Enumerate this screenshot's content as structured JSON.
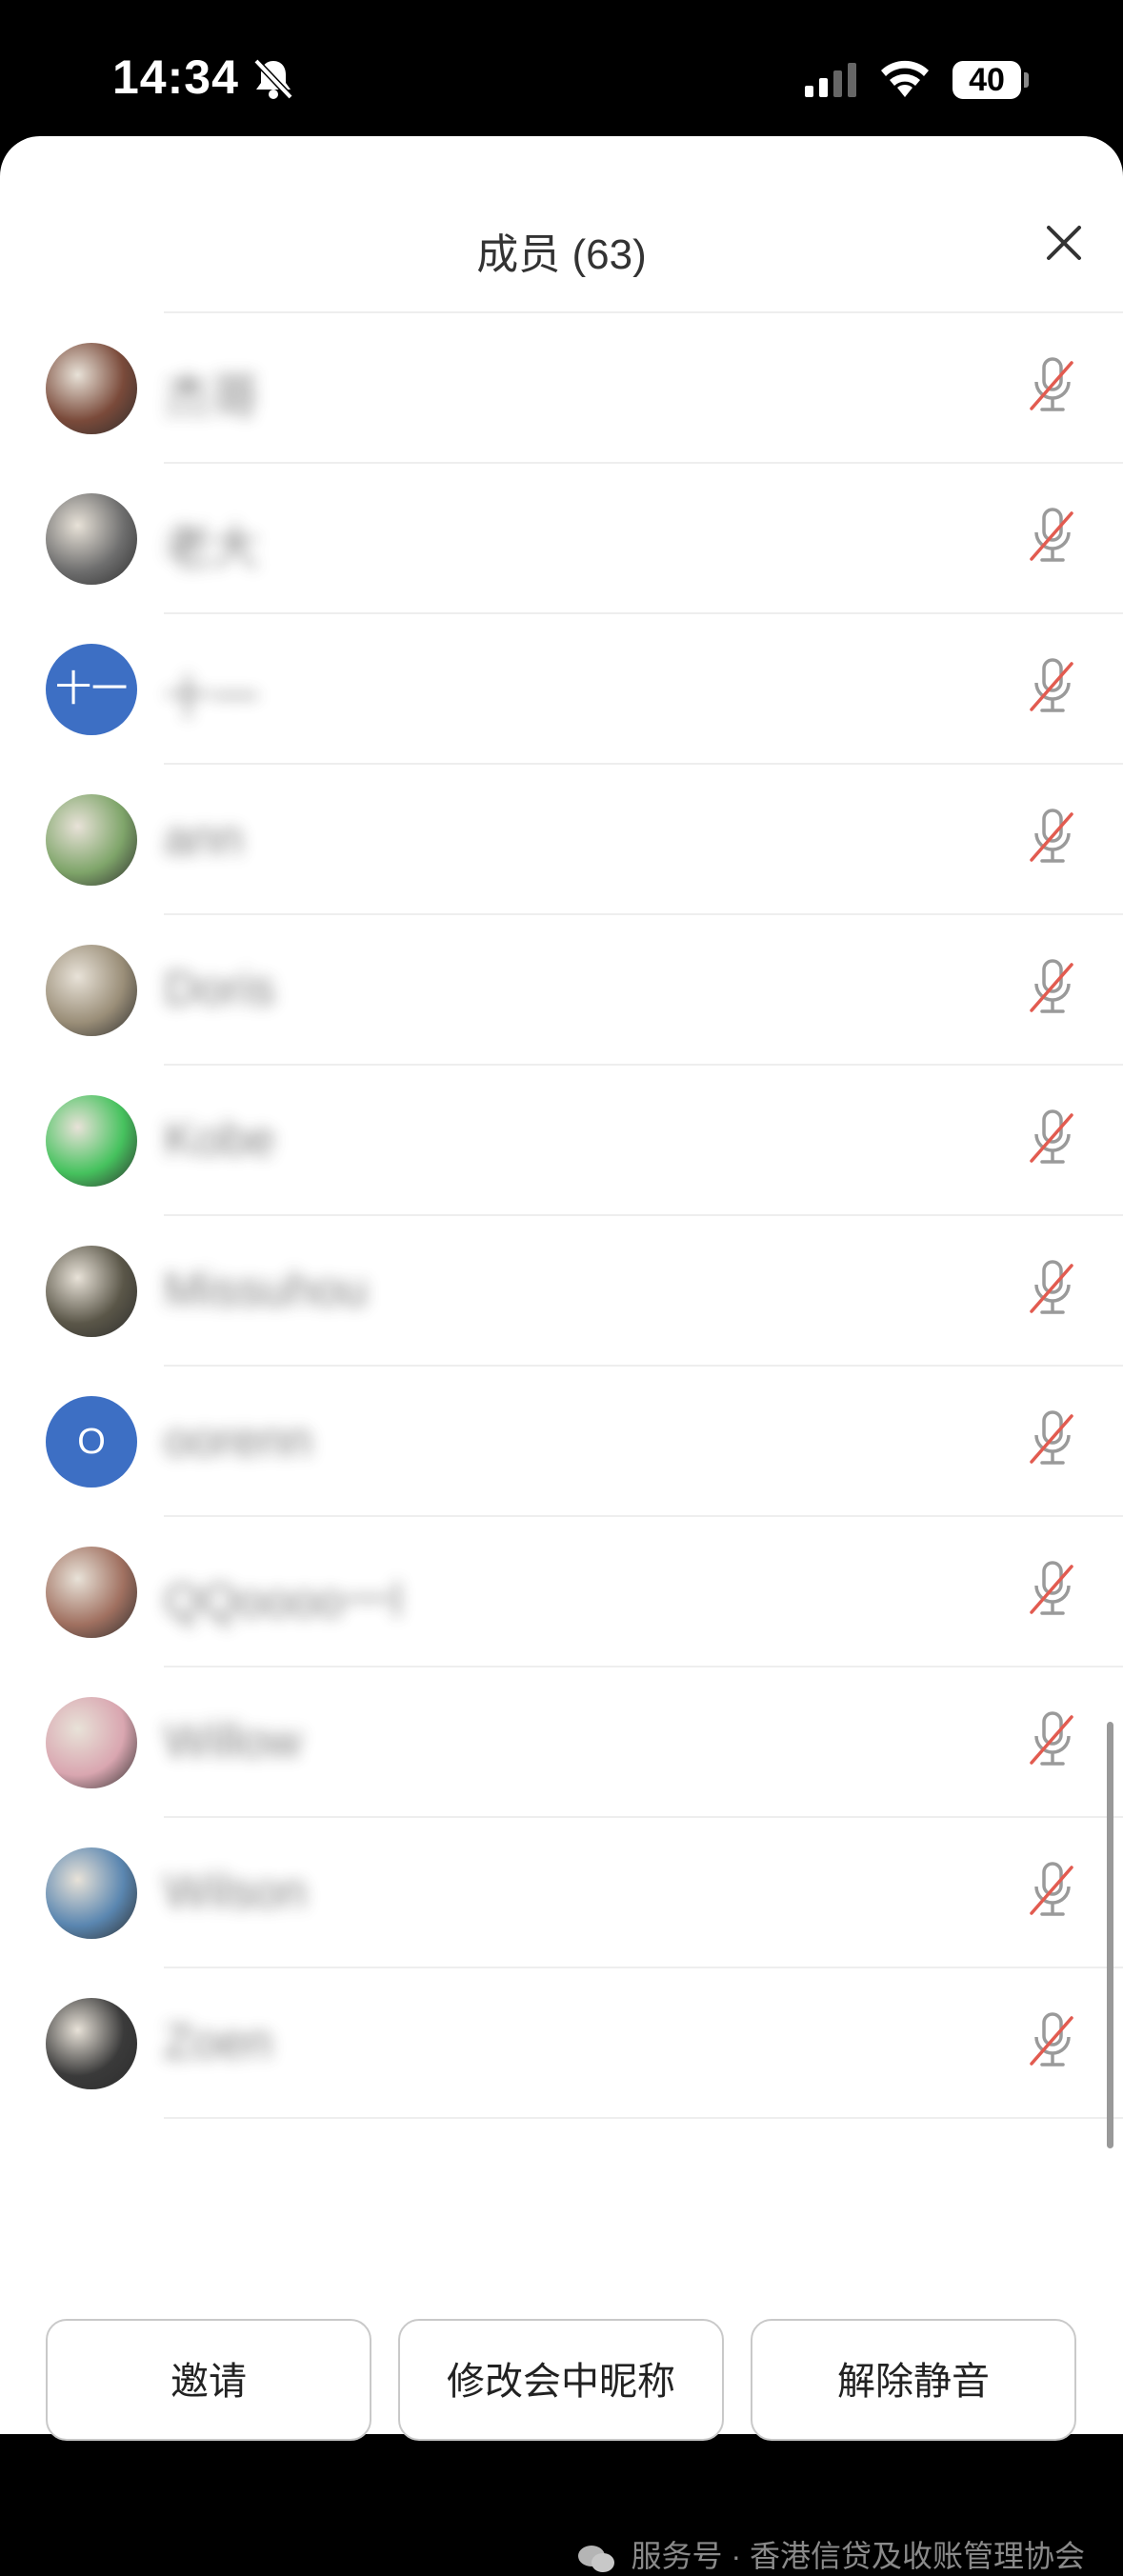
{
  "status": {
    "time": "14:34",
    "battery": "40"
  },
  "sheet": {
    "title": "成员 (63)"
  },
  "members": [
    {
      "name": "杰哥",
      "avatar": "photo",
      "avatar_color": "#7a4a3a"
    },
    {
      "name": "老大",
      "avatar": "photo",
      "avatar_color": "#6e6e6e"
    },
    {
      "name": "十一",
      "avatar": "text",
      "avatar_text": "十一"
    },
    {
      "name": "ann",
      "avatar": "photo",
      "avatar_color": "#7fa56a"
    },
    {
      "name": "Doris",
      "avatar": "photo",
      "avatar_color": "#9a8e78"
    },
    {
      "name": "Kobe",
      "avatar": "photo",
      "avatar_color": "#46c25e"
    },
    {
      "name": "Missuhou",
      "avatar": "photo",
      "avatar_color": "#5a5648"
    },
    {
      "name": "oorenn",
      "avatar": "text",
      "avatar_text": "O"
    },
    {
      "name": "QQoooo一l",
      "avatar": "photo",
      "avatar_color": "#a07060"
    },
    {
      "name": "Willow",
      "avatar": "photo",
      "avatar_color": "#d9a6b0"
    },
    {
      "name": "Wilson",
      "avatar": "photo",
      "avatar_color": "#5a86b0"
    },
    {
      "name": "Zoen",
      "avatar": "photo",
      "avatar_color": "#3a3a3a"
    }
  ],
  "actions": {
    "invite": "邀请",
    "rename": "修改会中昵称",
    "unmute": "解除静音"
  },
  "footer": {
    "text": "服务号 · 香港信贷及收账管理协会"
  },
  "colors": {
    "accent": "#3d6fc4",
    "muted_slash": "#e25b50"
  }
}
